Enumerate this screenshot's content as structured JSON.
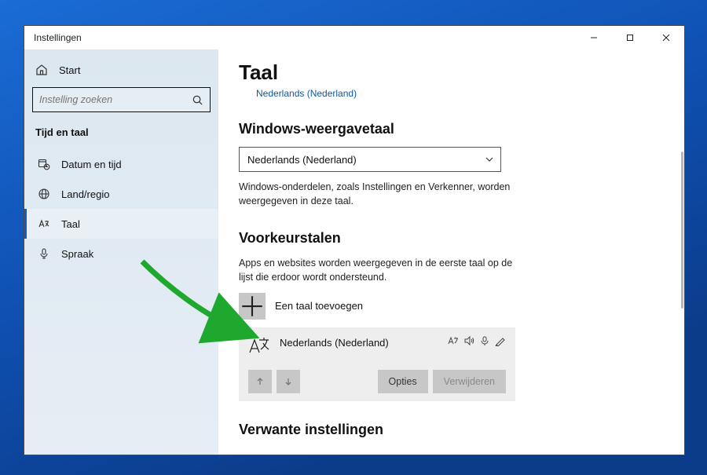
{
  "window": {
    "title": "Instellingen"
  },
  "sidebar": {
    "home": "Start",
    "search_placeholder": "Instelling zoeken",
    "heading": "Tijd en taal",
    "items": [
      {
        "label": "Datum en tijd"
      },
      {
        "label": "Land/regio"
      },
      {
        "label": "Taal"
      },
      {
        "label": "Spraak"
      }
    ],
    "selected_index": 2
  },
  "page": {
    "title": "Taal",
    "subtitle_link": "Nederlands (Nederland)"
  },
  "display_language": {
    "heading": "Windows-weergavetaal",
    "selected": "Nederlands (Nederland)",
    "description": "Windows-onderdelen, zoals Instellingen en Verkenner, worden weergegeven in deze taal."
  },
  "preferred_languages": {
    "heading": "Voorkeurstalen",
    "description": "Apps en websites worden weergegeven in de eerste taal op de lijst die erdoor wordt ondersteund.",
    "add_label": "Een taal toevoegen",
    "items": [
      {
        "name": "Nederlands (Nederland)"
      }
    ],
    "options_button": "Opties",
    "remove_button": "Verwijderen"
  },
  "related": {
    "heading": "Verwante instellingen"
  }
}
